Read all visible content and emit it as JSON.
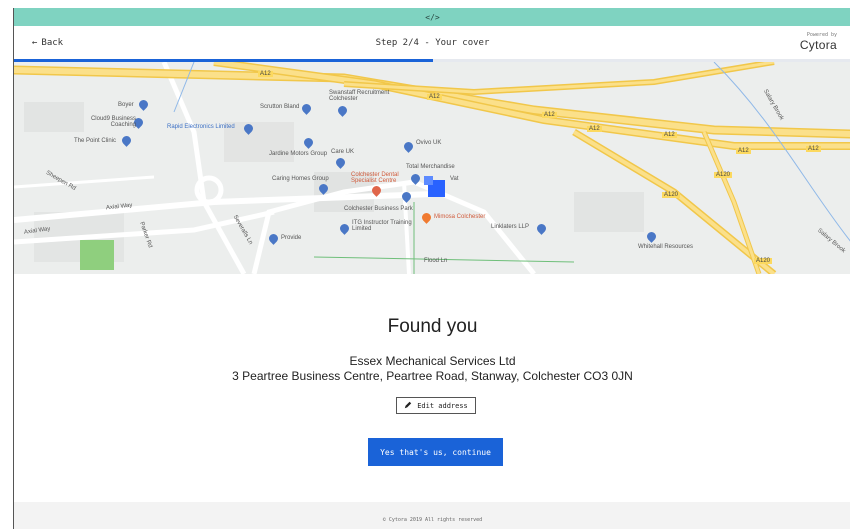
{
  "devbar": {
    "label": "</>"
  },
  "header": {
    "back_label": "Back",
    "step_label": "Step 2/4 - Your cover",
    "powered_by": "Powered by",
    "brand": "Cytora",
    "progress": 0.5
  },
  "map": {
    "roads": [
      "A12",
      "A12",
      "A12",
      "A12",
      "A12",
      "A12",
      "A12",
      "A120",
      "A120",
      "A120"
    ],
    "places": [
      "Boyer",
      "Cloud9 Business Coaching",
      "The Point Clinic",
      "Rapid Electronics Limited",
      "Scrutton Bland",
      "Swanstaff Recruitment Colchester",
      "Jardine Motors Group",
      "Care UK",
      "Colchester Dental Specialist Centre",
      "Caring Homes Group",
      "Ovivo UK",
      "Total Merchandise",
      "Vat",
      "Colchester Business Park",
      "Mimosa Colchester",
      "ITG Instructor Training Limited",
      "Provide",
      "Linklaters LLP",
      "Whitehall Resources",
      "Salary Brook",
      "Salary Brook"
    ],
    "streets": [
      "Axial Way",
      "Axial Way",
      "Flood Ln",
      "Parker Rd",
      "Severalls Ln",
      "Sheepen Rd"
    ]
  },
  "main": {
    "title": "Found you",
    "company": "Essex Mechanical Services Ltd",
    "address": "3 Peartree Business Centre, Peartree Road, Stanway, Colchester CO3 0JN",
    "edit_label": "Edit address",
    "cta_label": "Yes that's us, continue"
  },
  "footer": {
    "copyright": "© Cytora 2019 All rights reserved"
  },
  "colors": {
    "accent": "#1a63d8",
    "devbar": "#7fd3c1",
    "footer_bg": "#f3f3f3"
  },
  "icons": {
    "back": "arrow-left-icon",
    "edit": "pencil-icon"
  }
}
